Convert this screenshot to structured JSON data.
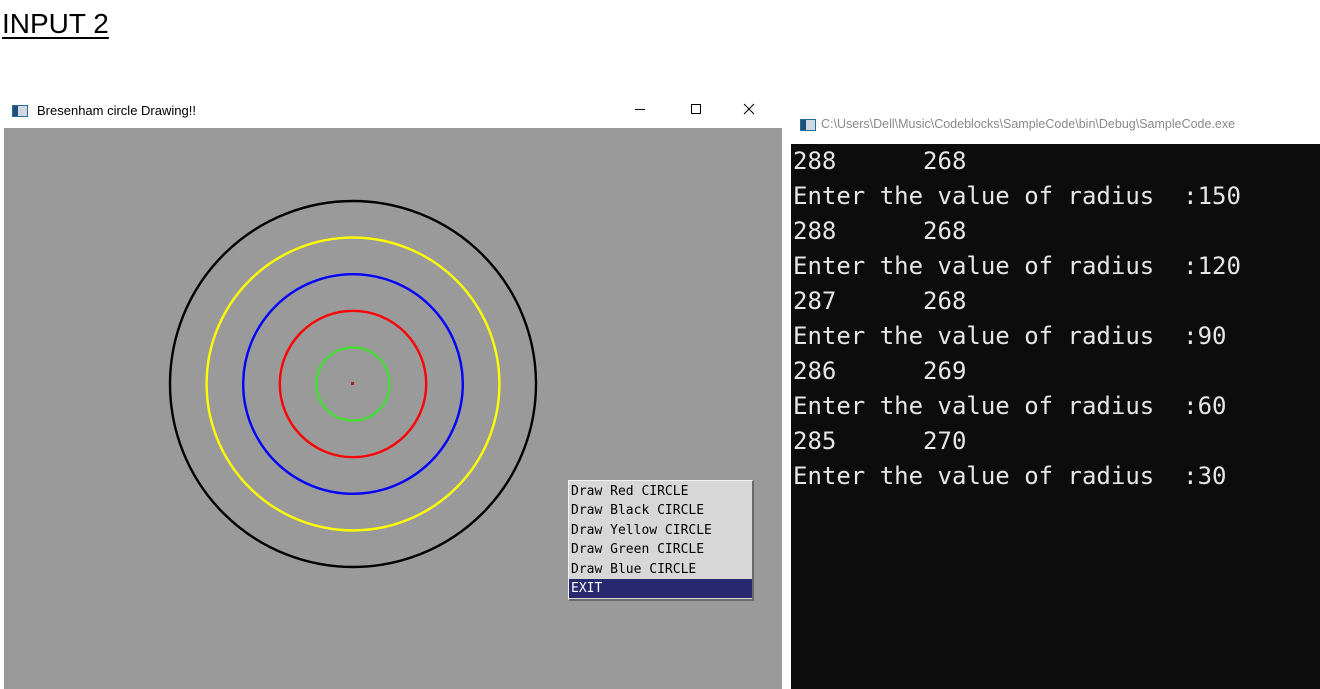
{
  "heading": "INPUT 2",
  "gl_window": {
    "title": "Bresenham circle Drawing!!",
    "controls": {
      "minimize_icon": "minimize-icon",
      "maximize_icon": "maximize-icon",
      "close_icon": "close-icon"
    },
    "canvas_background": "#9a9a9a",
    "circles": [
      {
        "name": "black-circle",
        "color": "#000000",
        "radius": 150
      },
      {
        "name": "yellow-circle",
        "color": "#ffff00",
        "radius": 120
      },
      {
        "name": "blue-circle",
        "color": "#0000ff",
        "radius": 90
      },
      {
        "name": "red-circle",
        "color": "#ff0000",
        "radius": 60
      },
      {
        "name": "green-circle",
        "color": "#44dd33",
        "radius": 30
      }
    ],
    "menu": [
      {
        "label": "Draw Red CIRCLE",
        "selected": false
      },
      {
        "label": "Draw Black CIRCLE",
        "selected": false
      },
      {
        "label": "Draw Yellow CIRCLE",
        "selected": false
      },
      {
        "label": "Draw Green CIRCLE",
        "selected": false
      },
      {
        "label": "Draw Blue CIRCLE",
        "selected": false
      },
      {
        "label": "EXIT",
        "selected": true
      }
    ],
    "menu_selected_color": "#28286e"
  },
  "console_window": {
    "title": "C:\\Users\\Dell\\Music\\Codeblocks\\SampleCode\\bin\\Debug\\SampleCode.exe",
    "lines": [
      "288      268",
      "Enter the value of radius  :150",
      "288      268",
      "Enter the value of radius  :120",
      "287      268",
      "Enter the value of radius  :90",
      "286      269",
      "Enter the value of radius  :60",
      "285      270",
      "Enter the value of radius  :30"
    ],
    "background": "#0c0c0c",
    "text_color": "#e6e6e6"
  }
}
